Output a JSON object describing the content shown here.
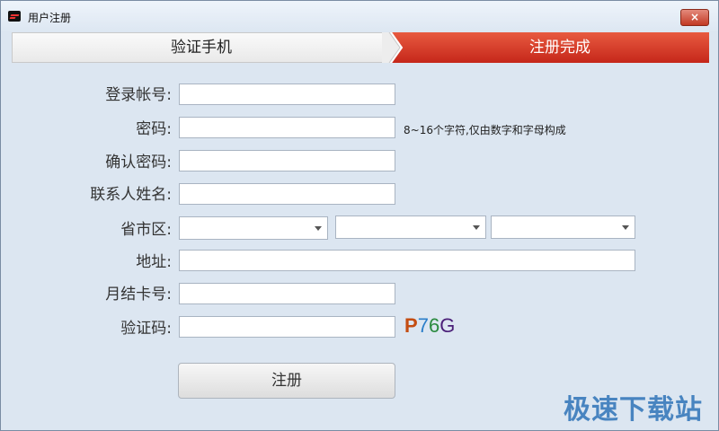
{
  "window": {
    "title": "用户注册",
    "close_label": "×"
  },
  "steps": [
    {
      "label": "验证手机"
    },
    {
      "label": "注册完成"
    }
  ],
  "form": {
    "account_label": "登录帐号:",
    "password_label": "密码:",
    "password_hint": "8~16个字符,仅由数字和字母构成",
    "confirm_label": "确认密码:",
    "contact_label": "联系人姓名:",
    "region_label": "省市区:",
    "address_label": "地址:",
    "card_label": "月结卡号:",
    "captcha_label": "验证码:",
    "captcha_chars": [
      "P",
      "7",
      "6",
      "G"
    ],
    "submit_label": "注册"
  },
  "watermark": "极速下载站",
  "colors": {
    "active_step": "#d8361f",
    "window_bg": "#dce6f1",
    "watermark": "#2f74b8"
  }
}
